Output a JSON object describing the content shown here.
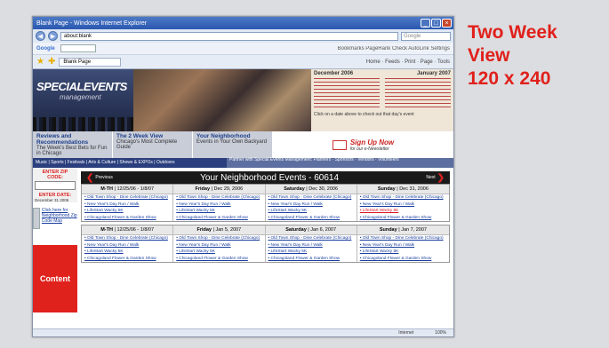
{
  "browser": {
    "title": "Blank Page - Windows Internet Explorer",
    "address": "about:blank",
    "search_placeholder": "Google",
    "google_label": "Google",
    "google_tools": "Bookmarks  PageRank  Check  AutoLink  Settings",
    "tab_label": "Blank Page",
    "command_bar": "Home · Feeds · Print · Page · Tools",
    "status_zone": "Internet",
    "zoom": "100%"
  },
  "site": {
    "logo_line1": "SPECIALEVENTS",
    "logo_line2": "management",
    "calendar": {
      "month1": "December 2006",
      "month2": "January 2007",
      "note": "Click on a date above to check out that day's event"
    },
    "subnav": [
      {
        "title": "Reviews and Recommendations",
        "desc": "The Week's Best Bets for Fun in Chicago"
      },
      {
        "title": "The 2 Week View",
        "desc": "Chicago's Most Complete Guide"
      },
      {
        "title": "Your Neighborhood",
        "desc": "Events in Your Own Backyard"
      }
    ],
    "signup": {
      "line1": "Sign Up Now",
      "line2": "for our e-Newsletter"
    },
    "navlinks": "Music | Sports | Festivals | Arts & Culture | Shows & EXPOs | Outdoors",
    "partner": "Partner with Special Events Management: Planners · Sponsors · Vendors · Volunteers",
    "zip_label": "ENTER ZIP CODE:",
    "date_label": "ENTER DATE:",
    "date_value": "December  31  2006",
    "map_link": "Click here for Neighborhood Zip Code Map",
    "content_label": "Content",
    "events": {
      "title": "Your Neighborhood Events - 60614",
      "prev": "Previous",
      "next": "Next",
      "week1": [
        {
          "day": "M-TH",
          "date": "12/25/06 - 1/8/07",
          "items": [
            "Old Town Shop - Dine Celebrate (Chicago)",
            "New Year's Day Run / Walk",
            "LifeStart Wacky 5K",
            "Chicagoland Flower & Garden Show"
          ],
          "red": -1
        },
        {
          "day": "Friday",
          "date": "Dec 29, 2006",
          "items": [
            "Old Town Shop - Dine Celebrate (Chicago)",
            "New Year's Day Run / Walk",
            "LifeStart Wacky 5K",
            "Chicagoland Flower & Garden Show"
          ],
          "red": -1
        },
        {
          "day": "Saturday",
          "date": "Dec 30, 2006",
          "items": [
            "Old Town Shop - Dine Celebrate (Chicago)",
            "New Year's Day Run / Walk",
            "LifeStart Wacky 5K",
            "Chicagoland Flower & Garden Show"
          ],
          "red": -1
        },
        {
          "day": "Sunday",
          "date": "Dec 31, 2006",
          "items": [
            "Old Town Shop - Dine Celebrate (Chicago)",
            "New Year's Day Run / Walk",
            "LifeStart Wacky 5K",
            "Chicagoland Flower & Garden Show"
          ],
          "red": 2
        }
      ],
      "week2": [
        {
          "day": "M-TH",
          "date": "12/25/06 - 1/8/07",
          "items": [
            "Old Town Shop - Dine Celebrate (Chicago)",
            "New Year's Day Run / Walk",
            "LifeStart Wacky 5K",
            "Chicagoland Flower & Garden Show"
          ],
          "red": -1
        },
        {
          "day": "Friday",
          "date": "Jan 5, 2007",
          "items": [
            "Old Town Shop - Dine Celebrate (Chicago)",
            "New Year's Day Run / Walk",
            "LifeStart Wacky 5K",
            "Chicagoland Flower & Garden Show"
          ],
          "red": -1
        },
        {
          "day": "Saturday",
          "date": "Jan 6, 2007",
          "items": [
            "Old Town Shop - Dine Celebrate (Chicago)",
            "New Year's Day Run / Walk",
            "LifeStart Wacky 5K",
            "Chicagoland Flower & Garden Show"
          ],
          "red": -1
        },
        {
          "day": "Sunday",
          "date": "Jan 7, 2007",
          "items": [
            "Old Town Shop - Dine Celebrate (Chicago)",
            "New Year's Day Run / Walk",
            "LifeStart Wacky 5K",
            "Chicagoland Flower & Garden Show"
          ],
          "red": -1
        }
      ]
    }
  },
  "caption": {
    "line1": "Two Week",
    "line2": "View",
    "line3": "120 x 240"
  },
  "colors": {
    "accent_red": "#e0201b",
    "nav_blue": "#2b3f7e"
  }
}
